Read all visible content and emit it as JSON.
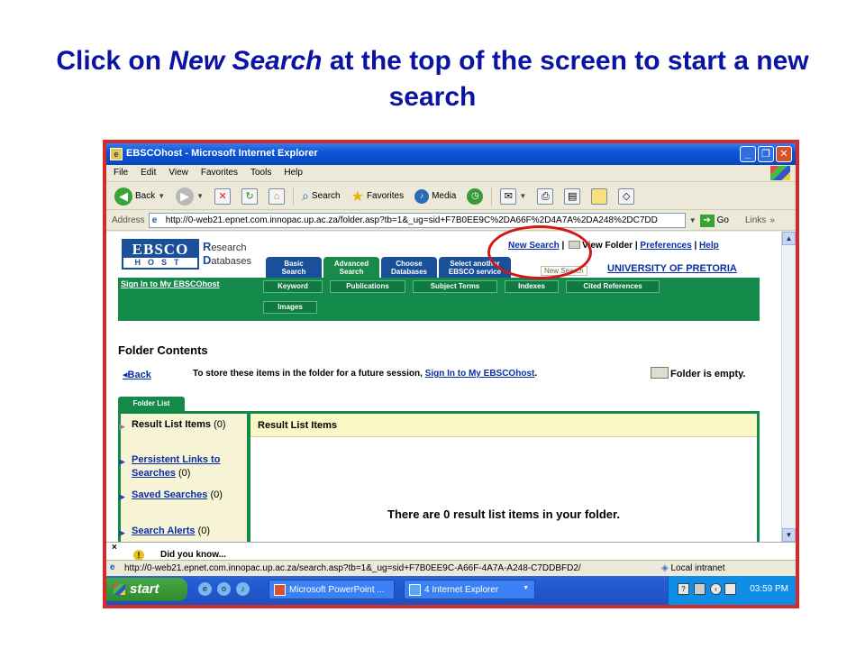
{
  "slide": {
    "title_before": "Click on ",
    "title_italic": "New Search",
    "title_after": " at the top of the screen to start a new search"
  },
  "window": {
    "title": "EBSCOhost - Microsoft Internet Explorer",
    "controls": {
      "minimize": "_",
      "maximize": "❐",
      "close": "✕"
    }
  },
  "menubar": {
    "items": [
      "File",
      "Edit",
      "View",
      "Favorites",
      "Tools",
      "Help"
    ]
  },
  "toolbar": {
    "back_label": "Back",
    "search_label": "Search",
    "favorites_label": "Favorites",
    "media_label": "Media"
  },
  "addressbar": {
    "label": "Address",
    "url": "http://0-web21.epnet.com.innopac.up.ac.za/folder.asp?tb=1&_ug=sid+F7B0EE9C%2DA66F%2D4A7A%2DA248%2DC7DD",
    "go_label": "Go",
    "links_label": "Links"
  },
  "ebsco": {
    "logo_top": "EBSCO",
    "logo_bottom": "HOST",
    "sub_line1_cap": "R",
    "sub_line1": "esearch",
    "sub_line2_cap": "D",
    "sub_line2": "atabases",
    "toplinks": {
      "new_search": "New Search",
      "view_folder": "View Folder",
      "preferences": "Preferences",
      "help": "Help",
      "separator": "|"
    },
    "tooltip": "New Search",
    "university": "UNIVERSITY OF PRETORIA",
    "tabs": [
      {
        "line1": "Basic",
        "line2": "Search"
      },
      {
        "line1": "Advanced",
        "line2": "Search"
      },
      {
        "line1": "Choose",
        "line2": "Databases"
      },
      {
        "line1": "Select another",
        "line2": "EBSCO service"
      }
    ],
    "signin": "Sign In to My EBSCOhost",
    "subnav": [
      "Keyword",
      "Publications",
      "Subject Terms",
      "Indexes",
      "Cited References",
      "Images"
    ]
  },
  "folder": {
    "title": "Folder Contents",
    "back": "Back",
    "store_msg": "To store these items in the folder for a future session, ",
    "store_link": "Sign In to My EBSCOhost",
    "store_end": ".",
    "empty": "Folder is empty.",
    "tab_label": "Folder List",
    "list": [
      {
        "label": "Result List Items",
        "count": "(0)"
      },
      {
        "label": "Persistent Links to Searches",
        "count": "(0)"
      },
      {
        "label": "Saved Searches",
        "count": "(0)"
      },
      {
        "label": "Search Alerts",
        "count": "(0)"
      }
    ],
    "results_header": "Result List Items",
    "results_empty": "There are 0 result list items in your folder."
  },
  "did_you_know": {
    "close": "×",
    "text": "Did you know..."
  },
  "statusbar": {
    "url": "http://0-web21.epnet.com.innopac.up.ac.za/search.asp?tb=1&_ug=sid+F7B0EE9C-A66F-4A7A-A248-C7DDBFD2/",
    "zone": "Local intranet"
  },
  "taskbar": {
    "start_label": "start",
    "buttons": [
      "Microsoft PowerPoint ...",
      "4 Internet Explorer"
    ],
    "clock": "03:59 PM"
  },
  "colors": {
    "slide_title": "#0b14a0",
    "frame": "#d42a2a",
    "ebsco_green": "#138a4a",
    "ebsco_blue": "#1a4f9a",
    "highlight_circle": "#d01818"
  }
}
